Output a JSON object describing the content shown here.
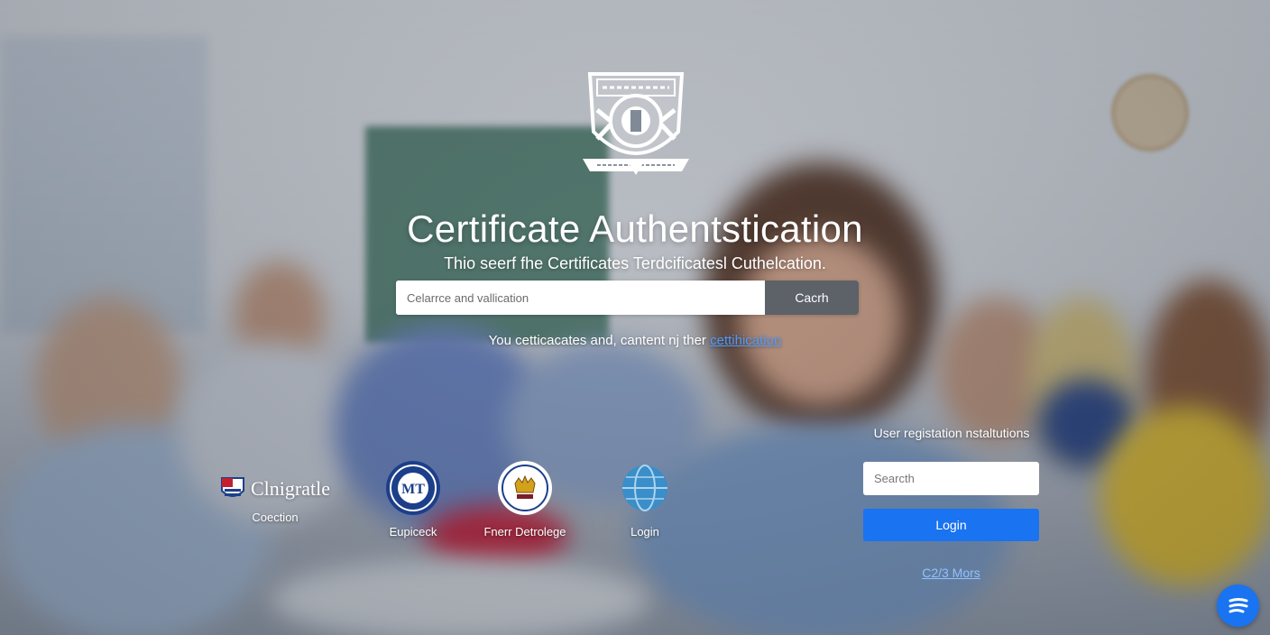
{
  "hero": {
    "title": "Certificate Authentstication",
    "subtitle": "Thio seerf fhe Certificates Terdcificatesl Cuthelcation."
  },
  "search": {
    "placeholder": "Celarrce and vallication",
    "button_label": "Cacrh"
  },
  "info": {
    "text": "You cetticacates and, cantent nj ther ",
    "link_text": "cettihication"
  },
  "partners": [
    {
      "logo_icon": "flag-shield-icon",
      "logo_text": "Clnigratle",
      "label": "Coection"
    },
    {
      "logo_icon": "university-seal-icon",
      "label": "Eupiceck"
    },
    {
      "logo_icon": "crown-seal-icon",
      "label": "Fnerr Detrolege"
    },
    {
      "logo_icon": "globe-seal-icon",
      "label": "Login"
    }
  ],
  "registration": {
    "label": "User registation nstaltutions",
    "input_placeholder": "Searcth",
    "login_label": "Login",
    "more_link": "C2/3 Mors"
  },
  "colors": {
    "accent": "#1a73f0",
    "link": "#4f9bff",
    "search_button": "#5d6168"
  },
  "icons": {
    "crest": "certificate-crest-icon",
    "chat": "chat-bubble-icon"
  }
}
